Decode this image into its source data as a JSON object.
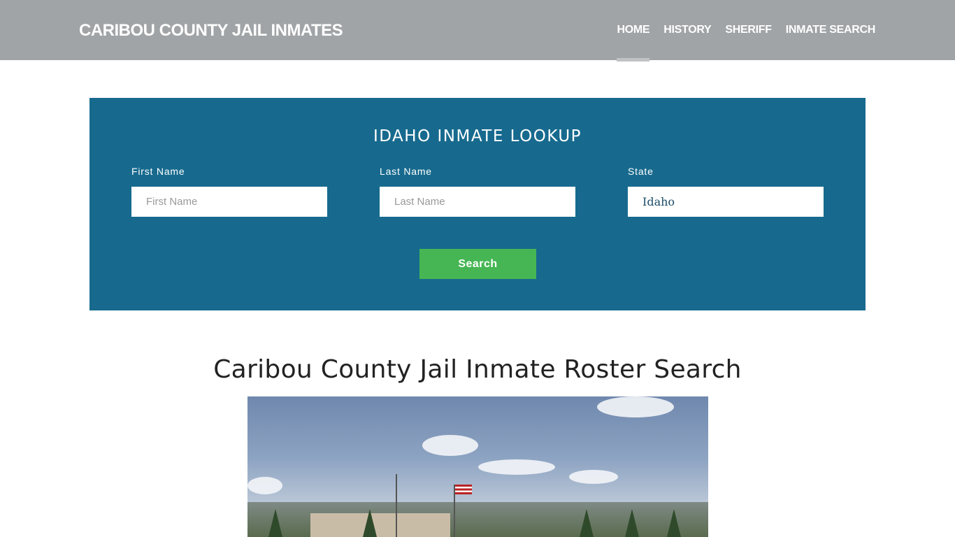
{
  "header": {
    "logo": "CARIBOU COUNTY JAIL INMATES",
    "nav": [
      {
        "label": "HOME",
        "active": true
      },
      {
        "label": "HISTORY"
      },
      {
        "label": "SHERIFF"
      },
      {
        "label": "INMATE SEARCH"
      }
    ]
  },
  "lookup": {
    "title": "IDAHO INMATE LOOKUP",
    "first_name": {
      "label": "First Name",
      "placeholder": "First Name",
      "value": ""
    },
    "last_name": {
      "label": "Last Name",
      "placeholder": "Last Name",
      "value": ""
    },
    "state": {
      "label": "State",
      "value": "Idaho"
    },
    "search_label": "Search",
    "colors": {
      "panel": "#176a8e",
      "button": "#45b653"
    }
  },
  "main": {
    "title": "Caribou County Jail Inmate Roster Search"
  }
}
